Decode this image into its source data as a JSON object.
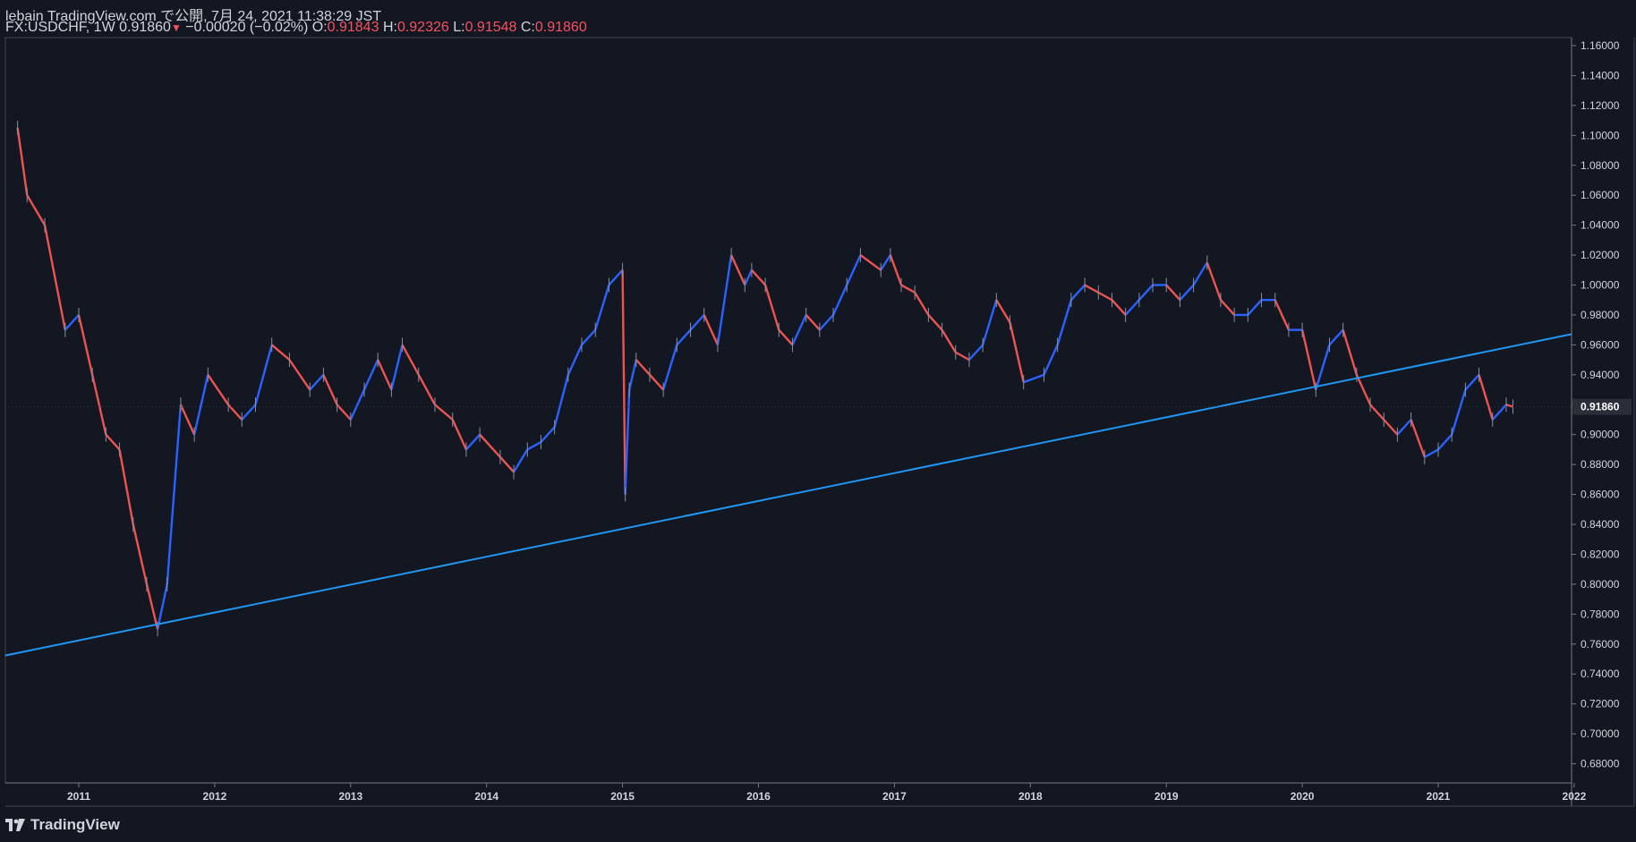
{
  "header": {
    "published": "lebain TradingView.com で公開, 7月 24, 2021 11:38:29 JST",
    "symbol": "FX:USDCHF, 1W 0.91860",
    "change_arrow": "▼",
    "change": "−0.00020 (−0.02%)",
    "o_label": "O:",
    "o_value": "0.91843",
    "h_label": "H:",
    "h_value": "0.92326",
    "l_label": "L:",
    "l_value": "0.91548",
    "c_label": "C:",
    "c_value": "0.91860"
  },
  "footer": {
    "brand": "TradingView"
  },
  "colors": {
    "background": "#131722",
    "up": "#2962ff",
    "down": "#ef5350",
    "trendline": "#2196f3",
    "text": "#d1d4dc",
    "price_label_bg": "#2a2e39"
  },
  "chart_data": {
    "type": "line",
    "title": "FX:USDCHF, 1W",
    "ylim": [
      0.67,
      1.165
    ],
    "y_ticks": [
      "1.16000",
      "1.14000",
      "1.12000",
      "1.10000",
      "1.08000",
      "1.06000",
      "1.04000",
      "1.02000",
      "1.00000",
      "0.98000",
      "0.96000",
      "0.94000",
      "0.92000",
      "0.90000",
      "0.88000",
      "0.86000",
      "0.84000",
      "0.82000",
      "0.80000",
      "0.78000",
      "0.76000",
      "0.74000",
      "0.72000",
      "0.70000",
      "0.68000"
    ],
    "x_ticks": [
      "2011",
      "2012",
      "2013",
      "2014",
      "2015",
      "2016",
      "2017",
      "2018",
      "2019",
      "2020",
      "2021",
      "2022"
    ],
    "current_price": "0.91860",
    "series": [
      {
        "x": [
          2010.55,
          2010.62,
          2010.75,
          2010.9,
          2011.0,
          2011.1,
          2011.2,
          2011.3,
          2011.4,
          2011.5,
          2011.58,
          2011.65,
          2011.75,
          2011.85,
          2011.95,
          2012.1,
          2012.2,
          2012.3,
          2012.42,
          2012.55,
          2012.7,
          2012.8,
          2012.9,
          2013.0,
          2013.1,
          2013.2,
          2013.3,
          2013.38,
          2013.5,
          2013.62,
          2013.75,
          2013.85,
          2013.95,
          2014.1,
          2014.2,
          2014.3,
          2014.4,
          2014.5,
          2014.6,
          2014.7,
          2014.8,
          2014.9,
          2015.0,
          2015.02,
          2015.05,
          2015.1,
          2015.2,
          2015.3,
          2015.4,
          2015.5,
          2015.6,
          2015.7,
          2015.8,
          2015.9,
          2015.95,
          2016.05,
          2016.15,
          2016.25,
          2016.35,
          2016.45,
          2016.55,
          2016.65,
          2016.75,
          2016.9,
          2016.97,
          2017.05,
          2017.15,
          2017.25,
          2017.35,
          2017.45,
          2017.55,
          2017.65,
          2017.75,
          2017.85,
          2017.95,
          2018.1,
          2018.2,
          2018.3,
          2018.4,
          2018.5,
          2018.6,
          2018.7,
          2018.8,
          2018.9,
          2019.0,
          2019.1,
          2019.2,
          2019.3,
          2019.4,
          2019.5,
          2019.6,
          2019.7,
          2019.8,
          2019.9,
          2020.0,
          2020.1,
          2020.2,
          2020.3,
          2020.4,
          2020.5,
          2020.6,
          2020.7,
          2020.8,
          2020.9,
          2021.0,
          2021.1,
          2021.2,
          2021.3,
          2021.4,
          2021.5,
          2021.55
        ],
        "values": [
          1.105,
          1.06,
          1.04,
          0.97,
          0.98,
          0.94,
          0.9,
          0.89,
          0.84,
          0.8,
          0.77,
          0.8,
          0.92,
          0.9,
          0.94,
          0.92,
          0.91,
          0.92,
          0.96,
          0.95,
          0.93,
          0.94,
          0.92,
          0.91,
          0.93,
          0.95,
          0.93,
          0.96,
          0.94,
          0.92,
          0.91,
          0.89,
          0.9,
          0.885,
          0.875,
          0.89,
          0.895,
          0.905,
          0.94,
          0.96,
          0.97,
          1.0,
          1.01,
          0.86,
          0.93,
          0.95,
          0.94,
          0.93,
          0.96,
          0.97,
          0.98,
          0.96,
          1.02,
          1.0,
          1.01,
          1.0,
          0.97,
          0.96,
          0.98,
          0.97,
          0.98,
          1.0,
          1.02,
          1.01,
          1.02,
          1.0,
          0.995,
          0.98,
          0.97,
          0.955,
          0.95,
          0.96,
          0.99,
          0.975,
          0.935,
          0.94,
          0.96,
          0.99,
          1.0,
          0.995,
          0.99,
          0.98,
          0.99,
          1.0,
          1.0,
          0.99,
          1.0,
          1.015,
          0.99,
          0.98,
          0.98,
          0.99,
          0.99,
          0.97,
          0.97,
          0.93,
          0.96,
          0.97,
          0.94,
          0.92,
          0.91,
          0.9,
          0.91,
          0.885,
          0.89,
          0.9,
          0.93,
          0.94,
          0.91,
          0.92,
          0.9186
        ]
      },
      {
        "x": [
          2010.0,
          2022.0
        ],
        "values": [
          0.7438,
          0.9675
        ]
      }
    ]
  }
}
